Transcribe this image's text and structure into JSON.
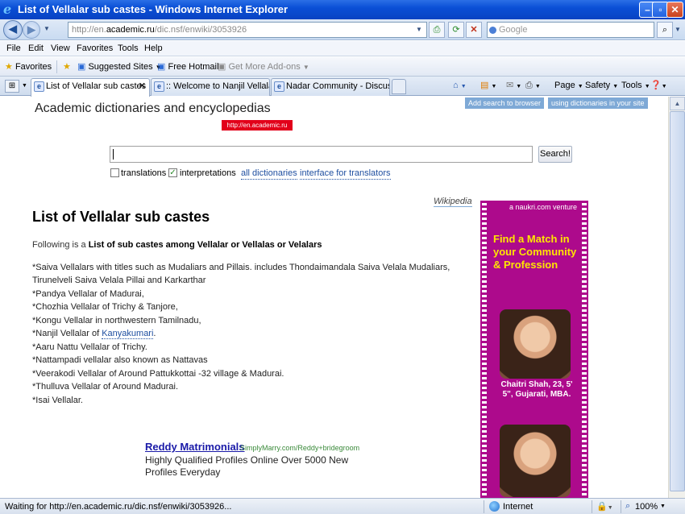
{
  "window": {
    "title": "List of Vellalar sub castes - Windows Internet Explorer"
  },
  "address": {
    "prefix": "http://en.",
    "domain": "academic.ru",
    "suffix": "/dic.nsf/enwiki/3053926"
  },
  "search_box": {
    "placeholder": "Google"
  },
  "menu": [
    "File",
    "Edit",
    "View",
    "Favorites",
    "Tools",
    "Help"
  ],
  "favorites_bar": {
    "favorites": "Favorites",
    "suggested": "Suggested Sites",
    "hotmail": "Free Hotmail",
    "addons": "Get More Add-ons"
  },
  "tabs": [
    {
      "label": "List of Vellalar sub castes"
    },
    {
      "label": ":: Welcome to Nanjil Vellalar ..."
    },
    {
      "label": "Nadar Community - Discussio..."
    }
  ],
  "toolbar": {
    "page": "Page",
    "safety": "Safety",
    "tools": "Tools"
  },
  "site": {
    "title": "Academic dictionaries and encyclopedias",
    "badge": "http://en.academic.ru",
    "add_search": "Add search to browser",
    "using_dicts": "using dictionaries in your site",
    "search_button": "Search!",
    "opt_translations": "translations",
    "opt_interpretations": "interpretations",
    "link_all_dictionaries": "all dictionaries",
    "link_interface": "interface for translators"
  },
  "article": {
    "source": "Wikipedia",
    "title": "List of Vellalar sub castes",
    "intro_prefix": "Following is a ",
    "intro_bold": "List of sub castes among Vellalar or Vellalas or Velalars",
    "lines": [
      "*Saiva Vellalars with titles such as Mudaliars and Pillais. includes Thondaimandala Saiva Velala Mudaliars,",
      "Tirunelveli Saiva Velala Pillai and Karkarthar",
      "*Pandya Vellalar of Madurai,",
      "*Chozhia Vellalar of Trichy & Tanjore,",
      "*Kongu Vellalar in northwestern Tamilnadu,",
      "*Nanjil Vellalar of ",
      "*Aaru Nattu Vellalar of Trichy.",
      "*Nattampadi vellalar also known as Nattavas",
      "*Veerakodi Vellalar of Around Pattukkottai -32 village & Madurai.",
      "*Thulluva Vellalar of Around Madurai.",
      "*Isai Vellalar."
    ],
    "kanyakumari_link": "Kanyakumari",
    "kanyakumari_tail": "."
  },
  "ad": {
    "title": "Reddy Matrimonials",
    "url": "SimplyMarry.com/Reddy+bridegroom",
    "desc1": "Highly Qualified Profiles Online Over 5000 New",
    "desc2": "Profiles Everyday"
  },
  "banner": {
    "head": "a naukri.com venture",
    "slogan": "Find a Match in your Community & Profession",
    "name": "Chaitri Shah, 23, 5' 5\", Gujarati, MBA."
  },
  "status": {
    "text": "Waiting for http://en.academic.ru/dic.nsf/enwiki/3053926...",
    "zone": "Internet",
    "zoom": "100%"
  }
}
